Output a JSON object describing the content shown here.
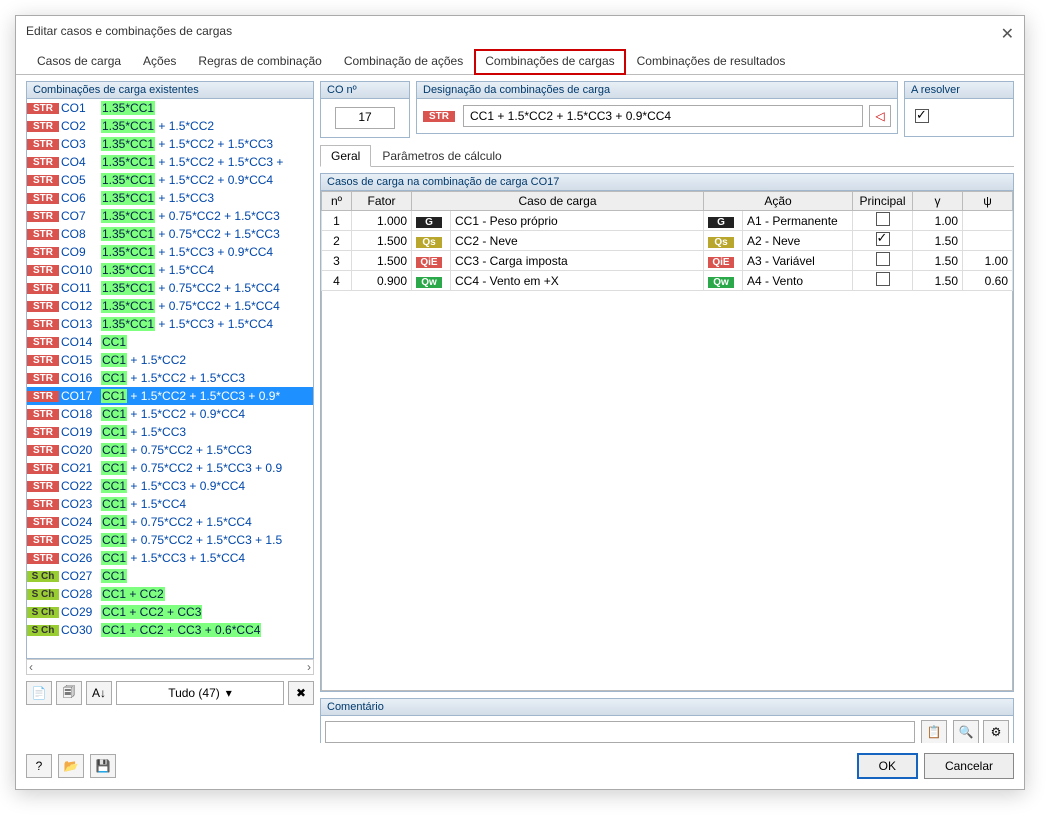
{
  "window": {
    "title": "Editar casos e combinações de cargas"
  },
  "tabs": [
    "Casos de carga",
    "Ações",
    "Regras de combinação",
    "Combinação de ações",
    "Combinações de cargas",
    "Combinações de resultados"
  ],
  "panels": {
    "existing": "Combinações de carga existentes",
    "co_no": "CO nº",
    "designation": "Designação da combinações de carga",
    "resolve": "A resolver",
    "cases_in_co": "Casos de carga na combinação de carga CO17",
    "comment": "Comentário"
  },
  "selected_co": "17",
  "designation_formula": "CC1 + 1.5*CC2 + 1.5*CC3 + 0.9*CC4",
  "designation_tag": "STR",
  "subtabs": [
    "Geral",
    "Parâmetros de cálculo"
  ],
  "combo_list": [
    {
      "tag": "STR",
      "name": "CO1",
      "f1": "1.35*CC1",
      "f2": ""
    },
    {
      "tag": "STR",
      "name": "CO2",
      "f1": "1.35*CC1",
      "f2": " + 1.5*CC2"
    },
    {
      "tag": "STR",
      "name": "CO3",
      "f1": "1.35*CC1",
      "f2": " + 1.5*CC2 + 1.5*CC3"
    },
    {
      "tag": "STR",
      "name": "CO4",
      "f1": "1.35*CC1",
      "f2": " + 1.5*CC2 + 1.5*CC3 +"
    },
    {
      "tag": "STR",
      "name": "CO5",
      "f1": "1.35*CC1",
      "f2": " + 1.5*CC2 + 0.9*CC4"
    },
    {
      "tag": "STR",
      "name": "CO6",
      "f1": "1.35*CC1",
      "f2": " + 1.5*CC3"
    },
    {
      "tag": "STR",
      "name": "CO7",
      "f1": "1.35*CC1",
      "f2": " + 0.75*CC2 + 1.5*CC3"
    },
    {
      "tag": "STR",
      "name": "CO8",
      "f1": "1.35*CC1",
      "f2": " + 0.75*CC2 + 1.5*CC3"
    },
    {
      "tag": "STR",
      "name": "CO9",
      "f1": "1.35*CC1",
      "f2": " + 1.5*CC3 + 0.9*CC4"
    },
    {
      "tag": "STR",
      "name": "CO10",
      "f1": "1.35*CC1",
      "f2": " + 1.5*CC4"
    },
    {
      "tag": "STR",
      "name": "CO11",
      "f1": "1.35*CC1",
      "f2": " + 0.75*CC2 + 1.5*CC4"
    },
    {
      "tag": "STR",
      "name": "CO12",
      "f1": "1.35*CC1",
      "f2": " + 0.75*CC2 + 1.5*CC4"
    },
    {
      "tag": "STR",
      "name": "CO13",
      "f1": "1.35*CC1",
      "f2": " + 1.5*CC3 + 1.5*CC4"
    },
    {
      "tag": "STR",
      "name": "CO14",
      "f1": "CC1",
      "f2": ""
    },
    {
      "tag": "STR",
      "name": "CO15",
      "f1": "CC1",
      "f2": " + 1.5*CC2"
    },
    {
      "tag": "STR",
      "name": "CO16",
      "f1": "CC1",
      "f2": " + 1.5*CC2 + 1.5*CC3"
    },
    {
      "tag": "STR",
      "name": "CO17",
      "f1": "CC1",
      "f2": " + 1.5*CC2 + 1.5*CC3 + 0.9*",
      "sel": true
    },
    {
      "tag": "STR",
      "name": "CO18",
      "f1": "CC1",
      "f2": " + 1.5*CC2 + 0.9*CC4"
    },
    {
      "tag": "STR",
      "name": "CO19",
      "f1": "CC1",
      "f2": " + 1.5*CC3"
    },
    {
      "tag": "STR",
      "name": "CO20",
      "f1": "CC1",
      "f2": " + 0.75*CC2 + 1.5*CC3"
    },
    {
      "tag": "STR",
      "name": "CO21",
      "f1": "CC1",
      "f2": " + 0.75*CC2 + 1.5*CC3 + 0.9"
    },
    {
      "tag": "STR",
      "name": "CO22",
      "f1": "CC1",
      "f2": " + 1.5*CC3 + 0.9*CC4"
    },
    {
      "tag": "STR",
      "name": "CO23",
      "f1": "CC1",
      "f2": " + 1.5*CC4"
    },
    {
      "tag": "STR",
      "name": "CO24",
      "f1": "CC1",
      "f2": " + 0.75*CC2 + 1.5*CC4"
    },
    {
      "tag": "STR",
      "name": "CO25",
      "f1": "CC1",
      "f2": " + 0.75*CC2 + 1.5*CC3 + 1.5"
    },
    {
      "tag": "STR",
      "name": "CO26",
      "f1": "CC1",
      "f2": " + 1.5*CC3 + 1.5*CC4"
    },
    {
      "tag": "SCh",
      "name": "CO27",
      "f1": "CC1",
      "f2": ""
    },
    {
      "tag": "SCh",
      "name": "CO28",
      "f1": "CC1 + CC2",
      "f2": ""
    },
    {
      "tag": "SCh",
      "name": "CO29",
      "f1": "CC1 + CC2 + CC3",
      "f2": ""
    },
    {
      "tag": "SCh",
      "name": "CO30",
      "f1": "CC1 + CC2 + CC3 + 0.6*CC4",
      "f2": ""
    }
  ],
  "lc_table": {
    "headers": [
      "nº",
      "Fator",
      "Caso de carga",
      "Ação",
      "Principal",
      "γ",
      "ψ"
    ],
    "rows": [
      {
        "n": "1",
        "factor": "1.000",
        "b": "G",
        "case": "CC1 - Peso próprio",
        "ab": "G",
        "action": "A1 - Permanente",
        "pr": false,
        "g": "1.00",
        "p": ""
      },
      {
        "n": "2",
        "factor": "1.500",
        "b": "Qs",
        "case": "CC2 - Neve",
        "ab": "Qs",
        "action": "A2 - Neve",
        "pr": true,
        "g": "1.50",
        "p": ""
      },
      {
        "n": "3",
        "factor": "1.500",
        "b": "QiE",
        "case": "CC3 - Carga imposta",
        "ab": "QiE",
        "action": "A3 - Variável",
        "pr": false,
        "g": "1.50",
        "p": "1.00"
      },
      {
        "n": "4",
        "factor": "0.900",
        "b": "Qw",
        "case": "CC4 - Vento em +X",
        "ab": "Qw",
        "action": "A4 - Vento",
        "pr": false,
        "g": "1.50",
        "p": "0.60"
      }
    ]
  },
  "tudo_label": "Tudo (47)",
  "buttons": {
    "ok": "OK",
    "cancel": "Cancelar"
  }
}
